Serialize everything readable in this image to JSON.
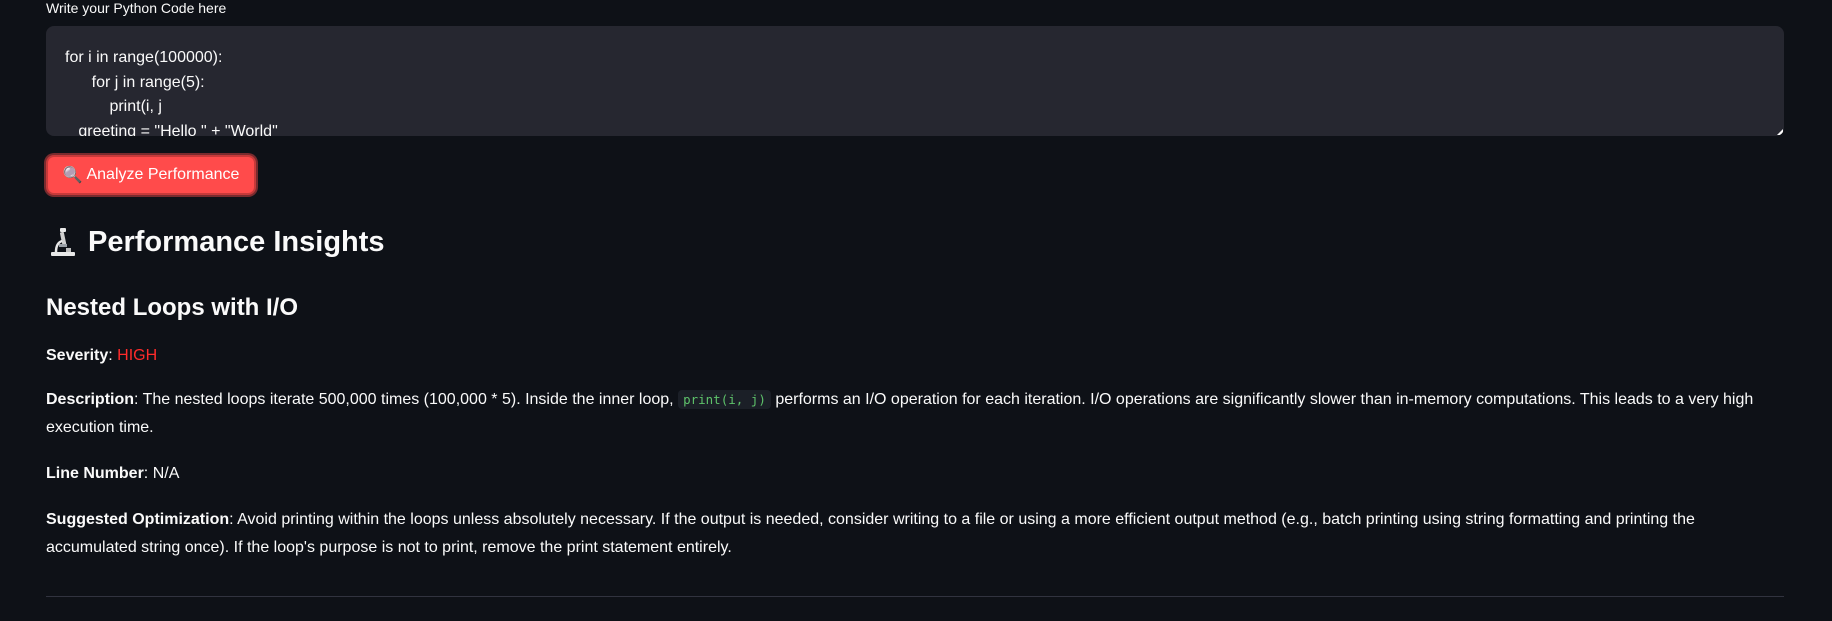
{
  "code_input": {
    "label": "Write your Python Code here",
    "value": "for i in range(100000):\n      for j in range(5):\n          print(i, j\n   greeting = \"Hello \" + \"World\""
  },
  "analyze_button": {
    "icon": "🔍",
    "label": "Analyze Performance"
  },
  "insights": {
    "heading": "Performance Insights",
    "heading_icon": "microscope-icon",
    "issue_title": "Nested Loops with I/O",
    "severity_label": "Severity",
    "severity_value": "HIGH",
    "description_label": "Description",
    "description_pre": ": The nested loops iterate 500,000 times (100,000 * 5). Inside the inner loop, ",
    "description_code": "print(i, j)",
    "description_post": " performs an I/O operation for each iteration. I/O operations are significantly slower than in-memory computations. This leads to a very high execution time.",
    "line_number_label": "Line Number",
    "line_number_value": ": N/A",
    "optimization_label": "Suggested Optimization",
    "optimization_value": ": Avoid printing within the loops unless absolutely necessary. If the output is needed, consider writing to a file or using a more efficient output method (e.g., batch printing using string formatting and printing the accumulated string once). If the loop's purpose is not to print, remove the print statement entirely."
  },
  "colors": {
    "background": "#0e1117",
    "editor_background": "#262730",
    "button": "#ff4b4b",
    "severity_high": "#ff2b2b",
    "inline_code": "#5ec26a"
  }
}
